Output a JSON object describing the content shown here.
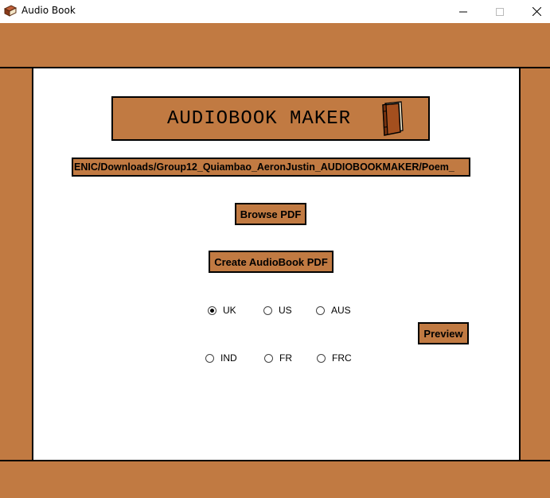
{
  "window": {
    "title": "Audio Book",
    "controls": {
      "minimize": "—",
      "maximize": "☐",
      "close": "✕"
    }
  },
  "header": {
    "title": "AUDIOBOOK MAKER",
    "icon": "book-icon"
  },
  "file_path": {
    "value": "ENIC/Downloads/Group12_Quiambao_AeronJustin_AUDIOBOOKMAKER/Poem_"
  },
  "buttons": {
    "browse": "Browse PDF",
    "create": "Create AudioBook PDF",
    "preview": "Preview"
  },
  "accents": {
    "selected": "UK",
    "row1": [
      "UK",
      "US",
      "AUS"
    ],
    "row2": [
      "IND",
      "FR",
      "FRC"
    ]
  },
  "colors": {
    "frame": "#c17a42",
    "content": "#ffffff",
    "border": "#000000"
  }
}
